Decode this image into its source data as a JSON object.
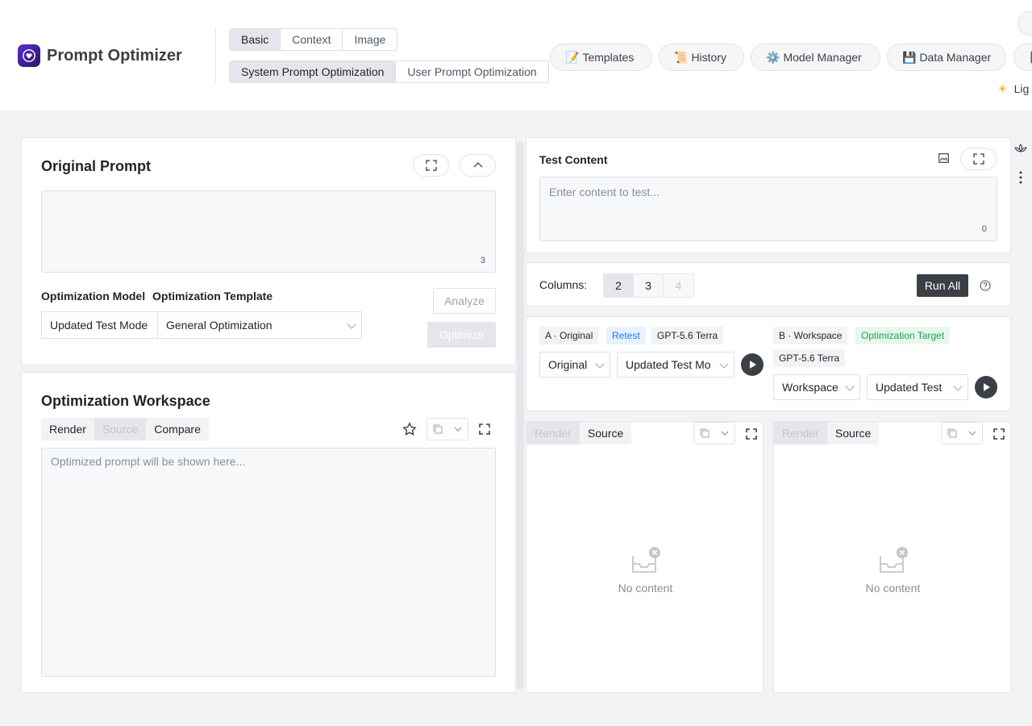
{
  "app": {
    "title": "Prompt Optimizer"
  },
  "header": {
    "mode_tabs": [
      "Basic",
      "Context",
      "Image"
    ],
    "optimization_tabs": [
      "System Prompt Optimization",
      "User Prompt Optimization"
    ],
    "nav": {
      "templates": "Templates",
      "history": "History",
      "model_manager": "Model Manager",
      "data_manager": "Data Manager"
    },
    "theme_label": "Lig"
  },
  "original_prompt": {
    "title": "Original Prompt",
    "char_count": "3",
    "model_label": "Optimization Model",
    "template_label": "Optimization Template",
    "model_value": "Updated Test Mode",
    "template_value": "General Optimization",
    "analyze_label": "Analyze",
    "optimize_label": "Optimize"
  },
  "workspace": {
    "title": "Optimization Workspace",
    "tabs": [
      "Render",
      "Source",
      "Compare"
    ],
    "placeholder": "Optimized prompt will be shown here..."
  },
  "test": {
    "title": "Test Content",
    "placeholder": "Enter content to test...",
    "char_count": "0",
    "columns_label": "Columns:",
    "columns": [
      "2",
      "3",
      "4"
    ],
    "run_all": "Run All"
  },
  "variant_a": {
    "tag": "A · Original",
    "retest": "Retest",
    "model_tag": "GPT-5.6 Terra",
    "source_value": "Original",
    "model_value": "Updated Test Mo"
  },
  "variant_b": {
    "tag": "B · Workspace",
    "target": "Optimization Target",
    "model_tag": "GPT-5.6 Terra",
    "source_value": "Workspace",
    "model_value": "Updated Test"
  },
  "result_panes": {
    "tabs": [
      "Render",
      "Source"
    ],
    "empty_text": "No content"
  },
  "colors": {
    "accent_dark": "#3b3f46",
    "logo": "#5b2bd8",
    "retest": "#1677ff",
    "target": "#18a058"
  }
}
